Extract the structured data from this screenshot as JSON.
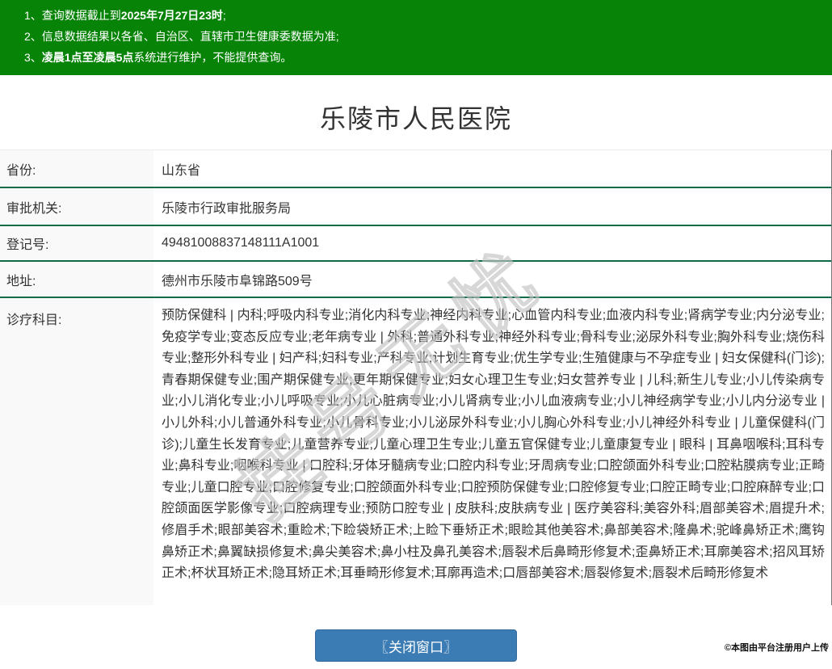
{
  "notice": {
    "lines": [
      {
        "num": "1、",
        "pre": "查询数据截止到",
        "bold": "2025年7月27日23时",
        "post": ";"
      },
      {
        "num": "2、",
        "pre": "信息数据结果以各省、自治区、直辖市卫生健康委数据为准;",
        "bold": "",
        "post": ""
      },
      {
        "num": "3、",
        "pre": "",
        "bold": "凌晨1点至凌晨5点",
        "post": "系统进行维护，不能提供查询。"
      }
    ]
  },
  "page": {
    "title": "乐陵市人民医院"
  },
  "table": {
    "rows": [
      {
        "label": "省份:",
        "value": "山东省"
      },
      {
        "label": "审批机关:",
        "value": "乐陵市行政审批服务局"
      },
      {
        "label": "登记号:",
        "value": "49481008837148111A1001"
      },
      {
        "label": "地址:",
        "value": "德州市乐陵市阜锦路509号"
      },
      {
        "label": "诊疗科目:",
        "value": "预防保健科 | 内科;呼吸内科专业;消化内科专业;神经内科专业;心血管内科专业;血液内科专业;肾病学专业;内分泌专业;免疫学专业;变态反应专业;老年病专业 | 外科;普通外科专业;神经外科专业;骨科专业;泌尿外科专业;胸外科专业;烧伤科专业;整形外科专业 | 妇产科;妇科专业;产科专业;计划生育专业;优生学专业;生殖健康与不孕症专业 | 妇女保健科(门诊);青春期保健专业;围产期保健专业;更年期保健专业;妇女心理卫生专业;妇女营养专业 | 儿科;新生儿专业;小儿传染病专业;小儿消化专业;小儿呼吸专业;小儿心脏病专业;小儿肾病专业;小儿血液病专业;小儿神经病学专业;小儿内分泌专业 | 小儿外科;小儿普通外科专业;小儿骨科专业;小儿泌尿外科专业;小儿胸心外科专业;小儿神经外科专业 | 儿童保健科(门诊);儿童生长发育专业;儿童营养专业;儿童心理卫生专业;儿童五官保健专业;儿童康复专业 | 眼科 | 耳鼻咽喉科;耳科专业;鼻科专业;咽喉科专业 | 口腔科;牙体牙髓病专业;口腔内科专业;牙周病专业;口腔颌面外科专业;口腔粘膜病专业;正畸专业;儿童口腔专业;口腔修复专业;口腔颌面外科专业;口腔预防保健专业;口腔修复专业;口腔正畸专业;口腔麻醉专业;口腔颌面医学影像专业;口腔病理专业;预防口腔专业 | 皮肤科;皮肤病专业 | 医疗美容科;美容外科;眉部美容术;眉提升术;修眉手术;眼部美容术;重睑术;下睑袋矫正术;上睑下垂矫正术;眼睑其他美容术;鼻部美容术;隆鼻术;驼峰鼻矫正术;鹰钩鼻矫正术;鼻翼缺损修复术;鼻尖美容术;鼻小柱及鼻孔美容术;唇裂术后鼻畸形修复术;歪鼻矫正术;耳廓美容术;招风耳矫正术;杯状耳矫正术;隐耳矫正术;耳垂畸形修复术;耳廓再造术;口唇部美容术;唇裂修复术;唇裂术后畸形修复术"
      }
    ]
  },
  "watermark": {
    "text": "挂号无忧"
  },
  "footer": {
    "close_button": "〖关闭窗口〗",
    "attribution": "©本图由平台注册用户上传"
  },
  "colors": {
    "header_green": "#078407",
    "row_border_green": "#0d6b45",
    "button_blue": "#3c7cb4",
    "label_bg": "#f9f9f9"
  }
}
